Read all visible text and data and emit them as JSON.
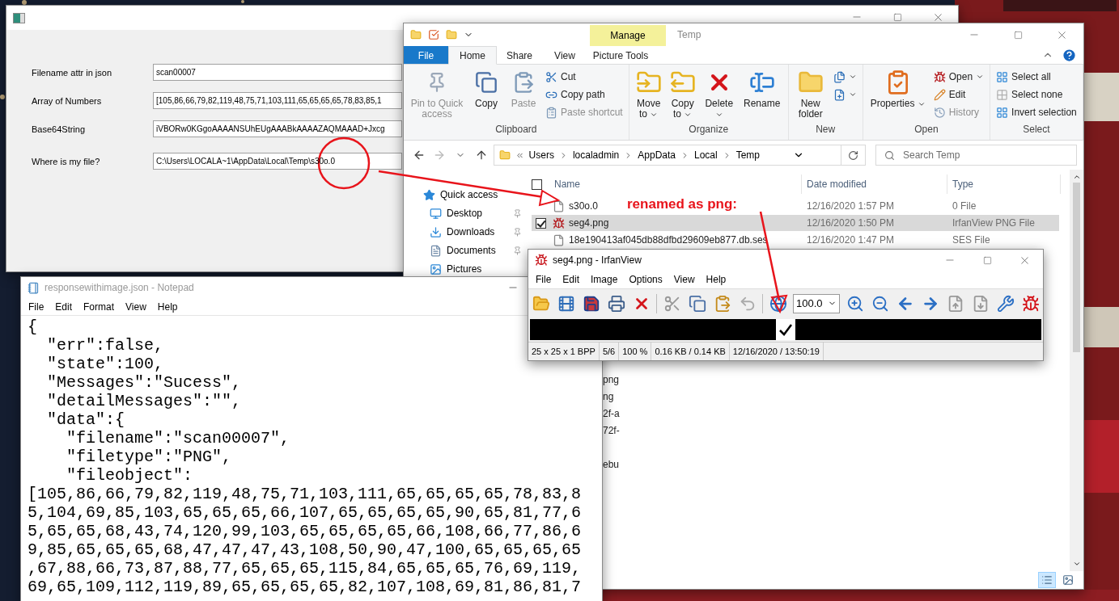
{
  "form_window": {
    "fields": [
      {
        "label": "Filename attr in json",
        "value": "scan00007"
      },
      {
        "label": "Array of Numbers",
        "value": "[105,86,66,79,82,119,48,75,71,103,111,65,65,65,65,78,83,85,1"
      },
      {
        "label": "Base64String",
        "value": "iVBORw0KGgoAAAANSUhEUgAAABkAAAAZAQMAAAD+Jxcg"
      },
      {
        "label": "Where is my file?",
        "value": "C:\\Users\\LOCALA~1\\AppData\\Local\\Temp\\s30o.0"
      }
    ]
  },
  "explorer": {
    "context_tab": "Manage",
    "title": "Temp",
    "tabs": [
      {
        "label": "File",
        "kind": "file",
        "selected": false
      },
      {
        "label": "Home",
        "kind": "tab",
        "selected": true
      },
      {
        "label": "Share",
        "kind": "tab",
        "selected": false
      },
      {
        "label": "View",
        "kind": "tab",
        "selected": false
      },
      {
        "label": "Picture Tools",
        "kind": "tab",
        "selected": false
      }
    ],
    "ribbon_groups": [
      {
        "name": "Clipboard",
        "items": [
          {
            "label": "Pin to Quick access",
            "kind": "large",
            "disabled": true,
            "menu": false
          },
          {
            "label": "Copy",
            "kind": "large",
            "disabled": false,
            "menu": false
          },
          {
            "label": "Paste",
            "kind": "large",
            "disabled": true,
            "menu": false
          },
          {
            "label": "Cut",
            "kind": "small",
            "disabled": false,
            "menu": false
          },
          {
            "label": "Copy path",
            "kind": "small",
            "disabled": false,
            "menu": false
          },
          {
            "label": "Paste shortcut",
            "kind": "small",
            "disabled": true,
            "menu": false
          }
        ]
      },
      {
        "name": "Organize",
        "items": [
          {
            "label": "Move to",
            "kind": "large",
            "disabled": false,
            "menu": true
          },
          {
            "label": "Copy to",
            "kind": "large",
            "disabled": false,
            "menu": true
          },
          {
            "label": "Delete",
            "kind": "large",
            "disabled": false,
            "menu": true
          },
          {
            "label": "Rename",
            "kind": "large",
            "disabled": false,
            "menu": false
          }
        ]
      },
      {
        "name": "New",
        "items": [
          {
            "label": "New folder",
            "kind": "large",
            "disabled": false,
            "menu": false
          },
          {
            "kind": "icon",
            "disabled": false,
            "menu": true
          },
          {
            "kind": "icon",
            "disabled": false,
            "menu": true
          }
        ]
      },
      {
        "name": "Open",
        "items": [
          {
            "label": "Properties",
            "kind": "large",
            "disabled": false,
            "menu": true
          },
          {
            "label": "Open",
            "kind": "small",
            "disabled": false,
            "menu": true
          },
          {
            "label": "Edit",
            "kind": "small",
            "disabled": false,
            "menu": false
          },
          {
            "label": "History",
            "kind": "small",
            "disabled": true,
            "menu": false
          }
        ]
      },
      {
        "name": "Select",
        "items": [
          {
            "label": "Select all",
            "kind": "small",
            "disabled": false,
            "menu": false
          },
          {
            "label": "Select none",
            "kind": "small",
            "disabled": false,
            "menu": false
          },
          {
            "label": "Invert selection",
            "kind": "small",
            "disabled": false,
            "menu": false
          }
        ]
      }
    ],
    "address": {
      "crumbs": [
        "Users",
        "localadmin",
        "AppData",
        "Local",
        "Temp"
      ]
    },
    "search": {
      "placeholder": "Search Temp"
    },
    "nav_items": [
      {
        "label": "Quick access",
        "pinned": false
      },
      {
        "label": "Desktop",
        "pinned": true
      },
      {
        "label": "Downloads",
        "pinned": true
      },
      {
        "label": "Documents",
        "pinned": true
      },
      {
        "label": "Pictures",
        "pinned": false
      }
    ],
    "select_all_checked": false,
    "columns": [
      "Name",
      "Date modified",
      "Type"
    ],
    "files": [
      {
        "name": "s30o.0",
        "date": "12/16/2020 1:57 PM",
        "type": "0 File",
        "selected": false,
        "checked": false
      },
      {
        "name": "seg4.png",
        "date": "12/16/2020 1:50 PM",
        "type": "IrfanView PNG File",
        "selected": true,
        "checked": true
      },
      {
        "name": "18e190413af045db88dfbd29609eb877.db.ses",
        "date": "12/16/2020 1:47 PM",
        "type": "SES File",
        "selected": false,
        "checked": false
      }
    ],
    "partial_names": [
      "png",
      "ng",
      "2f-a",
      "72f-",
      "ebu"
    ]
  },
  "irfanview": {
    "title": "seg4.png - IrfanView",
    "menu": [
      "File",
      "Edit",
      "Image",
      "Options",
      "View",
      "Help"
    ],
    "zoom": "100.0",
    "status": [
      "25 x 25 x 1 BPP",
      "5/6",
      "100 %",
      "0.16 KB / 0.14 KB",
      "12/16/2020 / 13:50:19"
    ]
  },
  "notepad": {
    "title": "responsewithimage.json - Notepad",
    "menu": [
      "File",
      "Edit",
      "Format",
      "View",
      "Help"
    ],
    "lines": [
      "{",
      "  \"err\":false,",
      "  \"state\":100,",
      "  \"Messages\":\"Sucess\",",
      "  \"detailMessages\":\"\",",
      "  \"data\":{",
      "    \"filename\":\"scan00007\",",
      "    \"filetype\":\"PNG\",",
      "    \"fileobject\":",
      "[105,86,66,79,82,119,48,75,71,103,111,65,65,65,65,78,83,8",
      "5,104,69,85,103,65,65,65,66,107,65,65,65,65,90,65,81,77,6",
      "5,65,65,68,43,74,120,99,103,65,65,65,65,66,108,66,77,86,6",
      "9,85,65,65,65,68,47,47,47,43,108,50,90,47,100,65,65,65,65",
      ",67,88,66,73,87,88,77,65,65,65,115,84,65,65,65,76,69,119,",
      "69,65,109,112,119,89,65,65,65,65,82,107,108,69,81,86,81,7"
    ]
  },
  "annotation": {
    "text": "renamed as png:"
  }
}
